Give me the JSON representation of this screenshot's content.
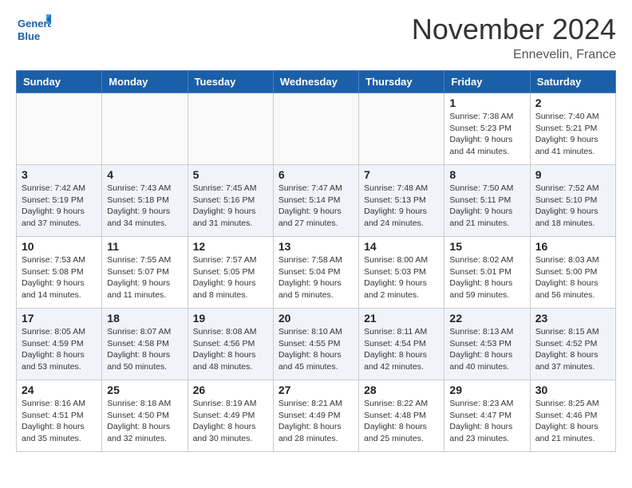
{
  "header": {
    "logo_line1": "General",
    "logo_line2": "Blue",
    "month": "November 2024",
    "location": "Ennevelin, France"
  },
  "weekdays": [
    "Sunday",
    "Monday",
    "Tuesday",
    "Wednesday",
    "Thursday",
    "Friday",
    "Saturday"
  ],
  "weeks": [
    [
      {
        "day": "",
        "info": ""
      },
      {
        "day": "",
        "info": ""
      },
      {
        "day": "",
        "info": ""
      },
      {
        "day": "",
        "info": ""
      },
      {
        "day": "",
        "info": ""
      },
      {
        "day": "1",
        "info": "Sunrise: 7:38 AM\nSunset: 5:23 PM\nDaylight: 9 hours\nand 44 minutes."
      },
      {
        "day": "2",
        "info": "Sunrise: 7:40 AM\nSunset: 5:21 PM\nDaylight: 9 hours\nand 41 minutes."
      }
    ],
    [
      {
        "day": "3",
        "info": "Sunrise: 7:42 AM\nSunset: 5:19 PM\nDaylight: 9 hours\nand 37 minutes."
      },
      {
        "day": "4",
        "info": "Sunrise: 7:43 AM\nSunset: 5:18 PM\nDaylight: 9 hours\nand 34 minutes."
      },
      {
        "day": "5",
        "info": "Sunrise: 7:45 AM\nSunset: 5:16 PM\nDaylight: 9 hours\nand 31 minutes."
      },
      {
        "day": "6",
        "info": "Sunrise: 7:47 AM\nSunset: 5:14 PM\nDaylight: 9 hours\nand 27 minutes."
      },
      {
        "day": "7",
        "info": "Sunrise: 7:48 AM\nSunset: 5:13 PM\nDaylight: 9 hours\nand 24 minutes."
      },
      {
        "day": "8",
        "info": "Sunrise: 7:50 AM\nSunset: 5:11 PM\nDaylight: 9 hours\nand 21 minutes."
      },
      {
        "day": "9",
        "info": "Sunrise: 7:52 AM\nSunset: 5:10 PM\nDaylight: 9 hours\nand 18 minutes."
      }
    ],
    [
      {
        "day": "10",
        "info": "Sunrise: 7:53 AM\nSunset: 5:08 PM\nDaylight: 9 hours\nand 14 minutes."
      },
      {
        "day": "11",
        "info": "Sunrise: 7:55 AM\nSunset: 5:07 PM\nDaylight: 9 hours\nand 11 minutes."
      },
      {
        "day": "12",
        "info": "Sunrise: 7:57 AM\nSunset: 5:05 PM\nDaylight: 9 hours\nand 8 minutes."
      },
      {
        "day": "13",
        "info": "Sunrise: 7:58 AM\nSunset: 5:04 PM\nDaylight: 9 hours\nand 5 minutes."
      },
      {
        "day": "14",
        "info": "Sunrise: 8:00 AM\nSunset: 5:03 PM\nDaylight: 9 hours\nand 2 minutes."
      },
      {
        "day": "15",
        "info": "Sunrise: 8:02 AM\nSunset: 5:01 PM\nDaylight: 8 hours\nand 59 minutes."
      },
      {
        "day": "16",
        "info": "Sunrise: 8:03 AM\nSunset: 5:00 PM\nDaylight: 8 hours\nand 56 minutes."
      }
    ],
    [
      {
        "day": "17",
        "info": "Sunrise: 8:05 AM\nSunset: 4:59 PM\nDaylight: 8 hours\nand 53 minutes."
      },
      {
        "day": "18",
        "info": "Sunrise: 8:07 AM\nSunset: 4:58 PM\nDaylight: 8 hours\nand 50 minutes."
      },
      {
        "day": "19",
        "info": "Sunrise: 8:08 AM\nSunset: 4:56 PM\nDaylight: 8 hours\nand 48 minutes."
      },
      {
        "day": "20",
        "info": "Sunrise: 8:10 AM\nSunset: 4:55 PM\nDaylight: 8 hours\nand 45 minutes."
      },
      {
        "day": "21",
        "info": "Sunrise: 8:11 AM\nSunset: 4:54 PM\nDaylight: 8 hours\nand 42 minutes."
      },
      {
        "day": "22",
        "info": "Sunrise: 8:13 AM\nSunset: 4:53 PM\nDaylight: 8 hours\nand 40 minutes."
      },
      {
        "day": "23",
        "info": "Sunrise: 8:15 AM\nSunset: 4:52 PM\nDaylight: 8 hours\nand 37 minutes."
      }
    ],
    [
      {
        "day": "24",
        "info": "Sunrise: 8:16 AM\nSunset: 4:51 PM\nDaylight: 8 hours\nand 35 minutes."
      },
      {
        "day": "25",
        "info": "Sunrise: 8:18 AM\nSunset: 4:50 PM\nDaylight: 8 hours\nand 32 minutes."
      },
      {
        "day": "26",
        "info": "Sunrise: 8:19 AM\nSunset: 4:49 PM\nDaylight: 8 hours\nand 30 minutes."
      },
      {
        "day": "27",
        "info": "Sunrise: 8:21 AM\nSunset: 4:49 PM\nDaylight: 8 hours\nand 28 minutes."
      },
      {
        "day": "28",
        "info": "Sunrise: 8:22 AM\nSunset: 4:48 PM\nDaylight: 8 hours\nand 25 minutes."
      },
      {
        "day": "29",
        "info": "Sunrise: 8:23 AM\nSunset: 4:47 PM\nDaylight: 8 hours\nand 23 minutes."
      },
      {
        "day": "30",
        "info": "Sunrise: 8:25 AM\nSunset: 4:46 PM\nDaylight: 8 hours\nand 21 minutes."
      }
    ]
  ]
}
